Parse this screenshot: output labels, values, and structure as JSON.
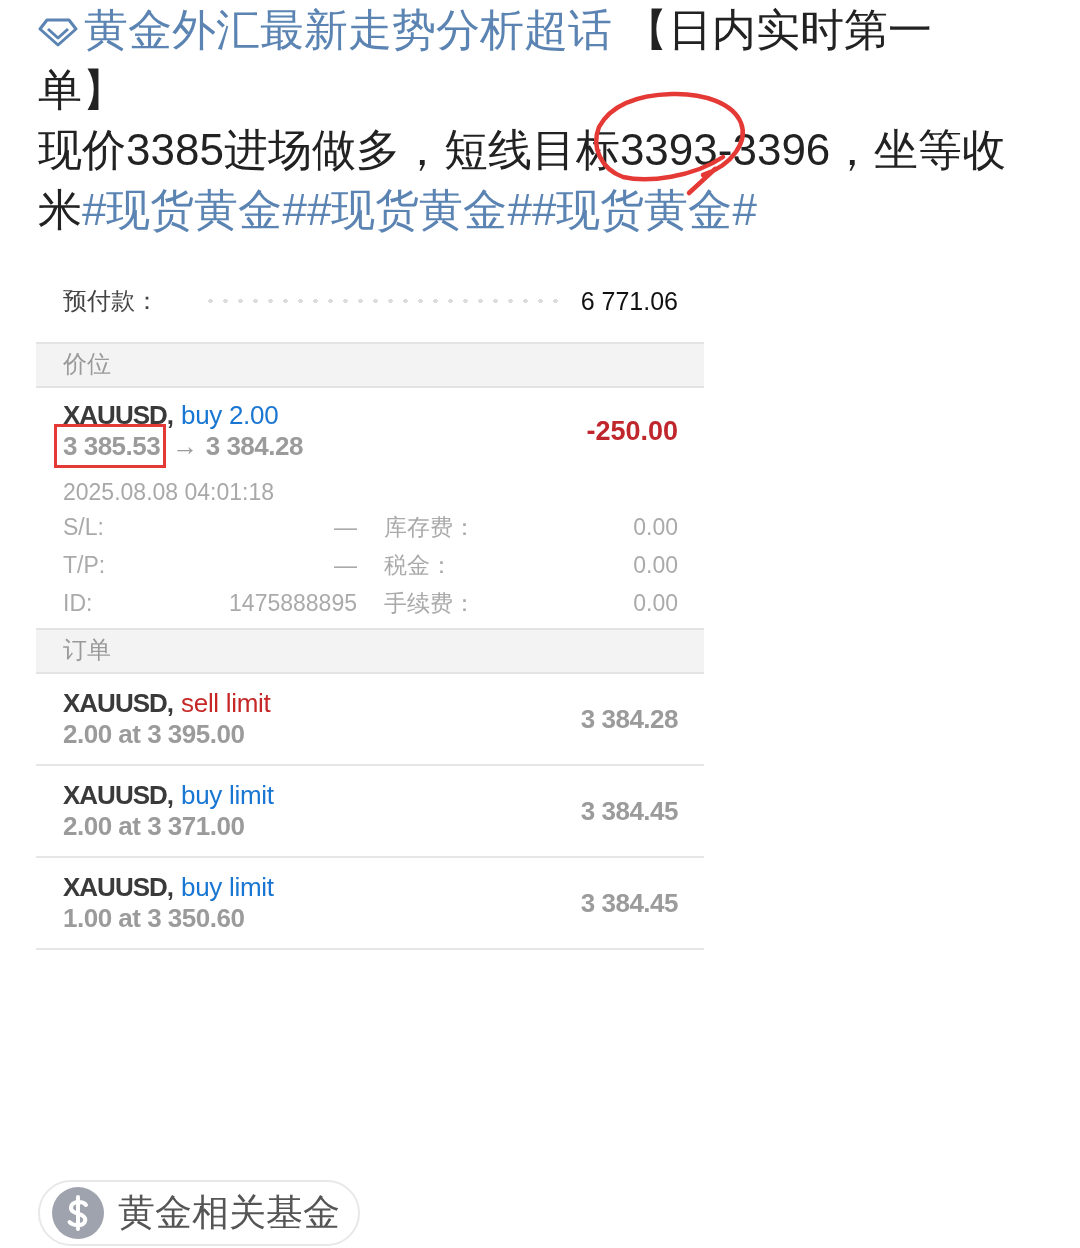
{
  "post": {
    "title": [
      {
        "kind": "topic",
        "text": "黄金外汇最新走势分析超话"
      },
      {
        "kind": "plain",
        "text": " 【日内实时第一单】"
      }
    ],
    "body": [
      {
        "kind": "plain",
        "text": "现价3385进场做多，短线目标"
      },
      {
        "kind": "circled",
        "text": "3393-"
      },
      {
        "kind": "plain",
        "text": "3396，坐等收米"
      },
      {
        "kind": "hashtag",
        "text": "#现货黄金#"
      },
      {
        "kind": "hashtag",
        "text": "#现货黄金#"
      },
      {
        "kind": "hashtag",
        "text": "#现货黄金#"
      }
    ]
  },
  "screenshot": {
    "summary": [
      {
        "label": "预付款：",
        "value": "6 771.06"
      }
    ],
    "position_header": "价位",
    "position": {
      "kind": "buy",
      "symbol": "XAUUSD,",
      "type": "buy 2.00",
      "open_price": "3 385.53",
      "open_price_boxed": true,
      "arrow": "→",
      "current_price": "3 384.28",
      "profit": "-250.00",
      "profit_loss": true,
      "time": "2025.08.08 04:01:18",
      "details": [
        {
          "label": "S/L:",
          "value": "—"
        },
        {
          "label": "库存费：",
          "value": "0.00"
        },
        {
          "label": "T/P:",
          "value": "—"
        },
        {
          "label": "税金：",
          "value": "0.00"
        },
        {
          "label": "ID:",
          "value": "1475888895"
        },
        {
          "label": "手续费：",
          "value": "0.00"
        }
      ]
    },
    "orders_header": "订单",
    "orders": [
      {
        "kind": "sell",
        "symbol": "XAUUSD,",
        "type": "sell limit",
        "volume_price": "2.00 at 3 395.00",
        "current": "3 384.28"
      },
      {
        "kind": "buy",
        "symbol": "XAUUSD,",
        "type": "buy limit",
        "volume_price": "2.00 at 3 371.00",
        "current": "3 384.45"
      },
      {
        "kind": "buy",
        "symbol": "XAUUSD,",
        "type": "buy limit",
        "volume_price": "1.00 at 3 350.60",
        "current": "3 384.45"
      }
    ]
  },
  "fund_button": {
    "label": "黄金相关基金"
  }
}
